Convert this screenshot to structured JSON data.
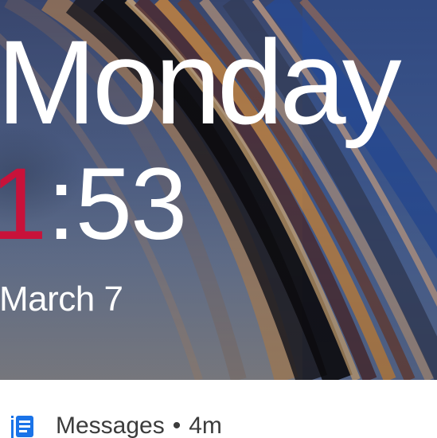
{
  "lock_screen": {
    "day": "Monday",
    "time": {
      "hour_first_digit": "1",
      "colon": ":",
      "rest": "53"
    },
    "date": "March 7",
    "accent_color": "#c8123a"
  },
  "notification": {
    "app_name": "Messages",
    "separator": "•",
    "age": "4m",
    "icon": "messages-app-icon",
    "icon_color": "#1a73e8"
  }
}
